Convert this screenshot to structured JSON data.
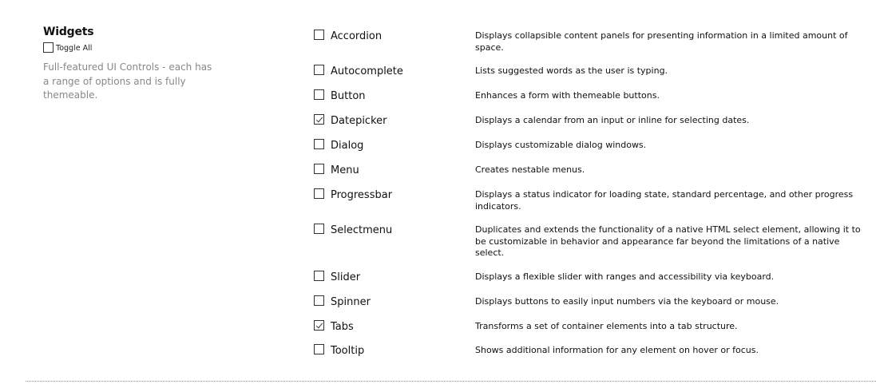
{
  "section": {
    "title": "Widgets",
    "toggle_all_label": "Toggle All",
    "toggle_all_checked": false,
    "intro": "Full-featured UI Controls - each has a range of options and is fully themeable."
  },
  "widgets": [
    {
      "name": "Accordion",
      "checked": false,
      "description": "Displays collapsible content panels for presenting information in a limited amount of space."
    },
    {
      "name": "Autocomplete",
      "checked": false,
      "description": "Lists suggested words as the user is typing."
    },
    {
      "name": "Button",
      "checked": false,
      "description": "Enhances a form with themeable buttons."
    },
    {
      "name": "Datepicker",
      "checked": true,
      "description": "Displays a calendar from an input or inline for selecting dates."
    },
    {
      "name": "Dialog",
      "checked": false,
      "description": "Displays customizable dialog windows."
    },
    {
      "name": "Menu",
      "checked": false,
      "description": "Creates nestable menus."
    },
    {
      "name": "Progressbar",
      "checked": false,
      "description": "Displays a status indicator for loading state, standard percentage, and other progress indicators."
    },
    {
      "name": "Selectmenu",
      "checked": false,
      "description": "Duplicates and extends the functionality of a native HTML select element, allowing it to be customizable in behavior and appearance far beyond the limitations of a native select."
    },
    {
      "name": "Slider",
      "checked": false,
      "description": "Displays a flexible slider with ranges and accessibility via keyboard."
    },
    {
      "name": "Spinner",
      "checked": false,
      "description": "Displays buttons to easily input numbers via the keyboard or mouse."
    },
    {
      "name": "Tabs",
      "checked": true,
      "description": "Transforms a set of container elements into a tab structure."
    },
    {
      "name": "Tooltip",
      "checked": false,
      "description": "Shows additional information for any element on hover or focus."
    }
  ]
}
